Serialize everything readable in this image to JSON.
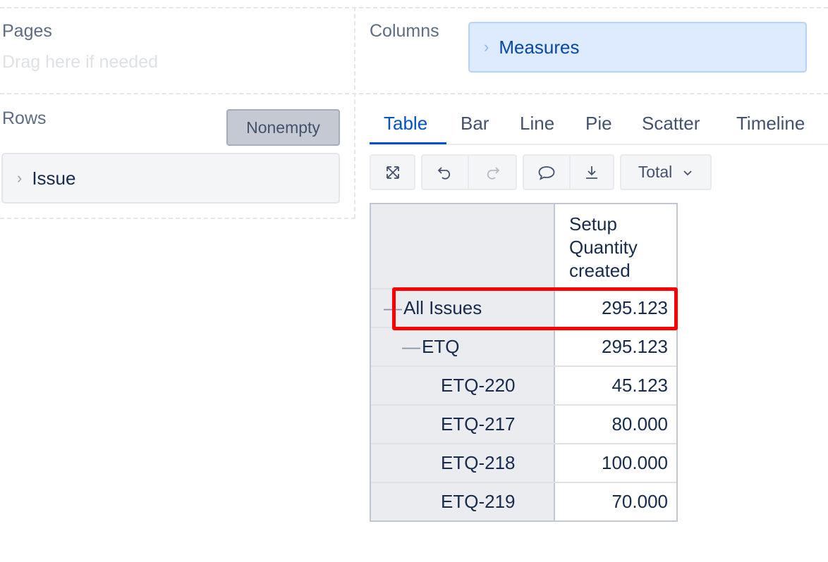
{
  "pages": {
    "title": "Pages",
    "hint": "Drag here if needed"
  },
  "columns": {
    "title": "Columns",
    "chip_label": "Measures"
  },
  "rows": {
    "title": "Rows",
    "nonempty_label": "Nonempty",
    "chip_label": "Issue"
  },
  "tabs": [
    {
      "label": "Table",
      "active": true
    },
    {
      "label": "Bar"
    },
    {
      "label": "Line"
    },
    {
      "label": "Pie"
    },
    {
      "label": "Scatter"
    },
    {
      "label": "Timeline"
    }
  ],
  "toolbar": {
    "fullscreen_icon": "expand-icon",
    "undo_icon": "undo-icon",
    "redo_icon": "redo-icon",
    "comment_icon": "comment-icon",
    "export_icon": "download-icon",
    "total_label": "Total"
  },
  "table": {
    "column_header": [
      "Setup",
      "Quantity",
      "created"
    ],
    "rows": [
      {
        "label": "All Issues",
        "value": "295.123",
        "highlighted": true
      },
      {
        "label": "ETQ",
        "value": "295.123"
      },
      {
        "label": "ETQ-220",
        "value": "45.123"
      },
      {
        "label": "ETQ-217",
        "value": "80.000"
      },
      {
        "label": "ETQ-218",
        "value": "100.000"
      },
      {
        "label": "ETQ-219",
        "value": "70.000"
      }
    ]
  },
  "colors": {
    "accent": "#0052cc",
    "highlight": "#ff0000",
    "chip_blue": "#deebff"
  }
}
